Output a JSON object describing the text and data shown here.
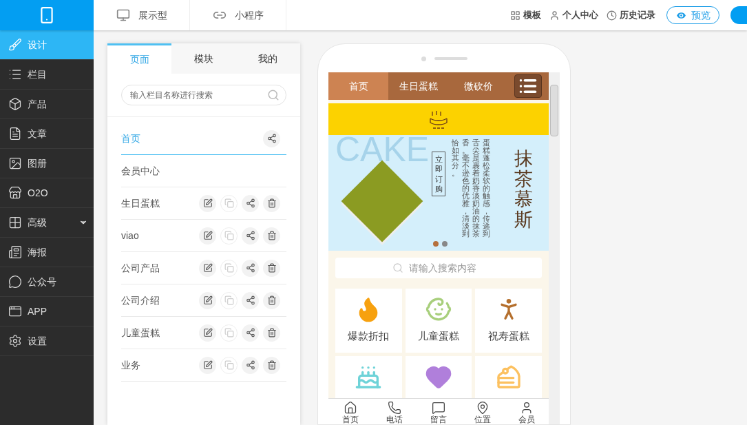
{
  "topbar": {
    "modes": [
      {
        "label": "展示型"
      },
      {
        "label": "小程序"
      }
    ],
    "links": [
      {
        "label": "模板"
      },
      {
        "label": "个人中心"
      },
      {
        "label": "历史记录"
      }
    ],
    "preview": "预览"
  },
  "sidebar": {
    "items": [
      {
        "label": "设计",
        "selected": true,
        "expandable": false
      },
      {
        "label": "栏目",
        "selected": false,
        "expandable": false
      },
      {
        "label": "产品",
        "selected": false,
        "expandable": false
      },
      {
        "label": "文章",
        "selected": false,
        "expandable": false
      },
      {
        "label": "图册",
        "selected": false,
        "expandable": false
      },
      {
        "label": "O2O",
        "selected": false,
        "expandable": false
      },
      {
        "label": "高级",
        "selected": false,
        "expandable": true
      },
      {
        "label": "海报",
        "selected": false,
        "expandable": false
      },
      {
        "label": "公众号",
        "selected": false,
        "expandable": false
      },
      {
        "label": "APP",
        "selected": false,
        "expandable": false
      },
      {
        "label": "设置",
        "selected": false,
        "expandable": false
      }
    ]
  },
  "panel": {
    "tabs": [
      {
        "label": "页面",
        "selected": true
      },
      {
        "label": "模块",
        "selected": false
      },
      {
        "label": "我的",
        "selected": false
      }
    ],
    "search": {
      "placeholder": "输入栏目名称进行搜索"
    },
    "pages": [
      {
        "label": "首页",
        "selected": true,
        "actions": [
          {
            "kind": "share",
            "disabled": false
          }
        ]
      },
      {
        "label": "会员中心",
        "selected": false
      },
      {
        "label": "生日蛋糕",
        "selected": false,
        "actions": [
          {
            "kind": "edit",
            "disabled": false
          },
          {
            "kind": "copy",
            "disabled": true
          },
          {
            "kind": "share",
            "disabled": false
          },
          {
            "kind": "delete",
            "disabled": false
          }
        ]
      },
      {
        "label": "viao",
        "selected": false,
        "actions": [
          {
            "kind": "edit",
            "disabled": false
          },
          {
            "kind": "copy",
            "disabled": true
          },
          {
            "kind": "share",
            "disabled": false
          },
          {
            "kind": "delete",
            "disabled": false
          }
        ]
      },
      {
        "label": "公司产品",
        "selected": false,
        "actions": [
          {
            "kind": "edit",
            "disabled": false
          },
          {
            "kind": "copy",
            "disabled": true
          },
          {
            "kind": "share",
            "disabled": false
          },
          {
            "kind": "delete",
            "disabled": false
          }
        ]
      },
      {
        "label": "公司介绍",
        "selected": false,
        "actions": [
          {
            "kind": "edit",
            "disabled": false
          },
          {
            "kind": "copy",
            "disabled": true
          },
          {
            "kind": "share",
            "disabled": false
          },
          {
            "kind": "delete",
            "disabled": false
          }
        ]
      },
      {
        "label": "儿童蛋糕",
        "selected": false,
        "actions": [
          {
            "kind": "edit",
            "disabled": false
          },
          {
            "kind": "copy",
            "disabled": true
          },
          {
            "kind": "share",
            "disabled": false
          },
          {
            "kind": "delete",
            "disabled": false
          }
        ]
      },
      {
        "label": "业务",
        "selected": false,
        "actions": [
          {
            "kind": "edit",
            "disabled": false
          },
          {
            "kind": "copy",
            "disabled": true
          },
          {
            "kind": "share",
            "disabled": false
          },
          {
            "kind": "delete",
            "disabled": false
          }
        ]
      }
    ]
  },
  "phone": {
    "nav": [
      {
        "label": "首页",
        "selected": true
      },
      {
        "label": "生日蛋糕",
        "selected": false
      },
      {
        "label": "微砍价",
        "selected": false
      }
    ],
    "banner": {
      "bg_text": "CAKE",
      "title": "抹茶慕斯",
      "order_button": "立即订购",
      "description_columns": [
        "恰如其分。",
        "香。毫不逊色的优雅，清淡到",
        "舌尖是裹着奶香淡奶油的抹茶",
        "蛋糕蓬松柔软的触感，传递到"
      ],
      "dots": [
        {
          "selected": true
        },
        {
          "selected": false
        }
      ]
    },
    "search": {
      "placeholder": "请输入搜索内容"
    },
    "categories": [
      {
        "label": "爆款折扣",
        "kind": "fire",
        "color": "#f7a10f"
      },
      {
        "label": "儿童蛋糕",
        "kind": "child",
        "color": "#a8cf7c"
      },
      {
        "label": "祝寿蛋糕",
        "kind": "elder",
        "color": "#b5702e"
      },
      {
        "kind": "tiered-cake",
        "color": "#6fd3d8"
      },
      {
        "kind": "heart",
        "color": "#b07fdb"
      },
      {
        "kind": "candle-cake",
        "color": "#fcc160"
      }
    ],
    "tabbar": [
      {
        "label": "首页",
        "kind": "home"
      },
      {
        "label": "电话",
        "kind": "phone"
      },
      {
        "label": "留言",
        "kind": "message"
      },
      {
        "label": "位置",
        "kind": "location"
      },
      {
        "label": "会员",
        "kind": "user"
      }
    ]
  }
}
